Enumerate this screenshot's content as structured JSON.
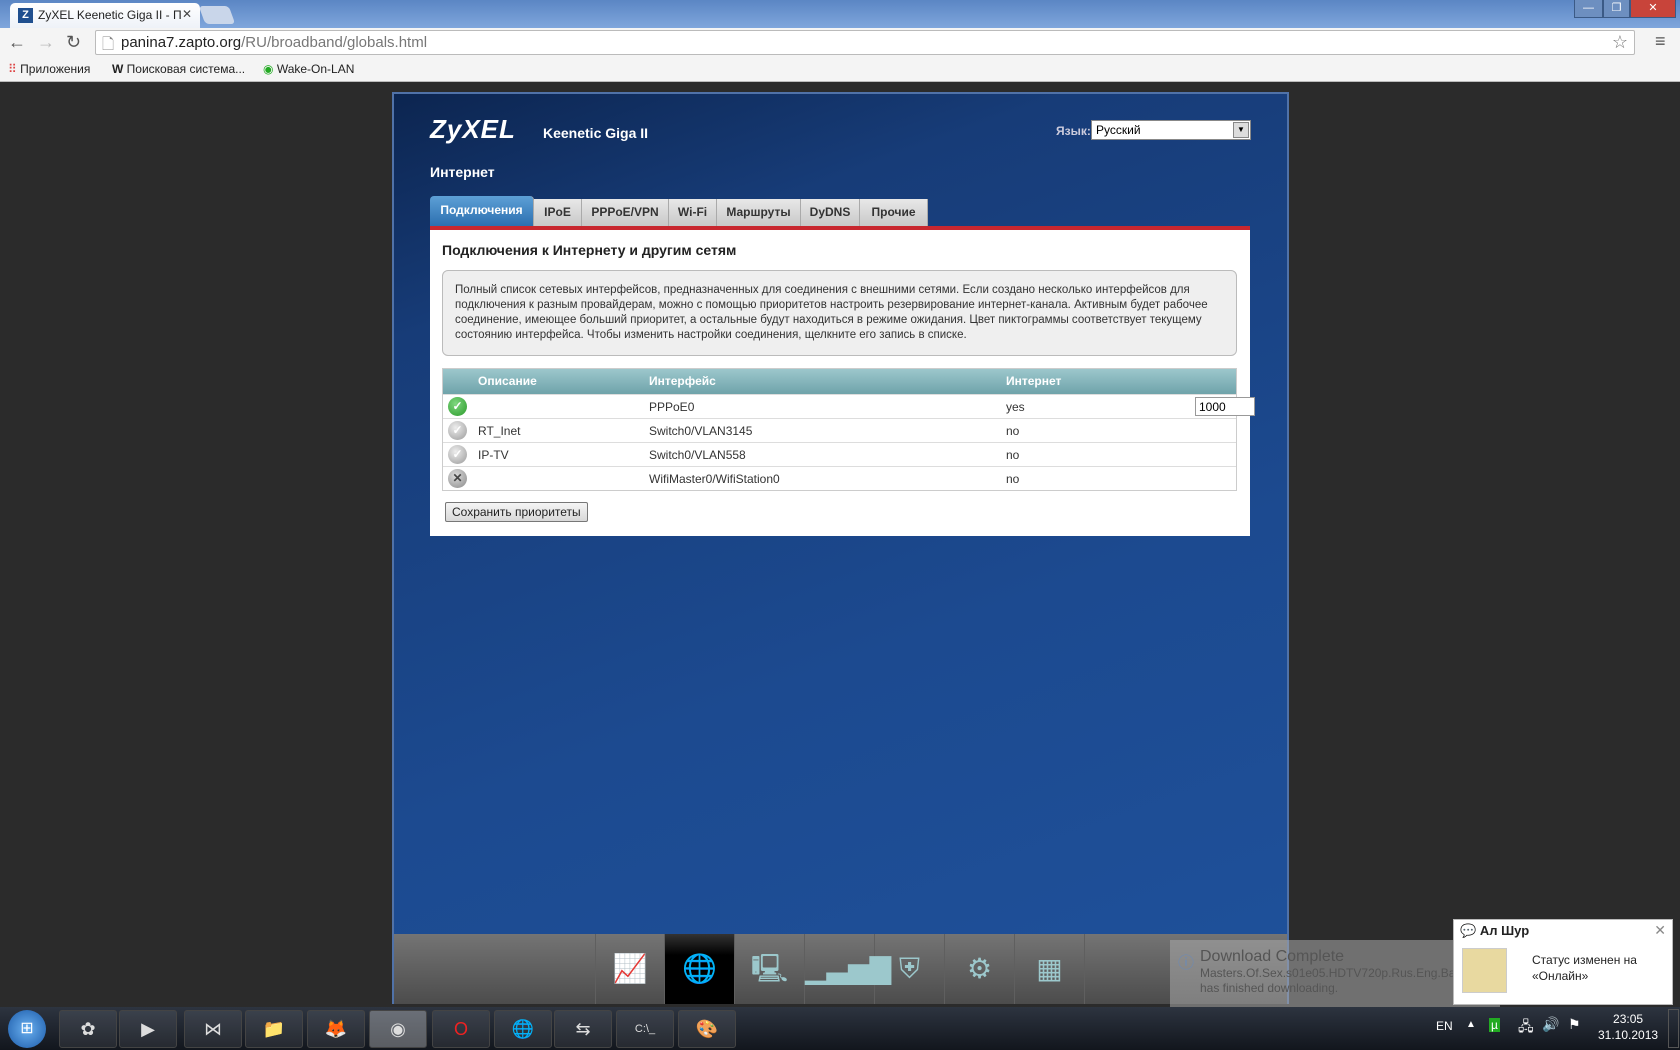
{
  "browser": {
    "tab_title": "ZyXEL Keenetic Giga II - П",
    "url_host": "panina7.zapto.org",
    "url_path": "/RU/broadband/globals.html",
    "bookmarks": [
      {
        "label": "Приложения",
        "icon": "apps-grid-icon"
      },
      {
        "label": "Поисковая система...",
        "icon": "w-icon"
      },
      {
        "label": "Wake-On-LAN",
        "icon": "wol-icon"
      }
    ]
  },
  "router": {
    "brand": "ZyXEL",
    "model": "Keenetic Giga II",
    "lang_label": "Язык:",
    "lang_value": "Русский",
    "section": "Интернет",
    "tabs": [
      {
        "label": "Подключения"
      },
      {
        "label": "IPoE"
      },
      {
        "label": "PPPoE/VPN"
      },
      {
        "label": "Wi-Fi"
      },
      {
        "label": "Маршруты"
      },
      {
        "label": "DyDNS"
      },
      {
        "label": "Прочие"
      }
    ],
    "heading": "Подключения к Интернету и другим сетям",
    "info": "Полный список сетевых интерфейсов, предназначенных для соединения с внешними сетями. Если создано несколько интерфейсов для подключения к разным провайдерам, можно с помощью приоритетов настроить резервирование интернет-канала. Активным будет рабочее соединение, имеющее больший приоритет, а остальные будут находиться в режиме ожидания. Цвет пиктограммы соответствует текущему состоянию интерфейса. Чтобы изменить настройки соединения, щелкните его запись в списке.",
    "columns": {
      "description": "Описание",
      "interface": "Интерфейс",
      "internet": "Интернет"
    },
    "rows": [
      {
        "status": "ok",
        "description": "",
        "interface": "PPPoE0",
        "internet": "yes",
        "priority": "1000"
      },
      {
        "status": "idle",
        "description": "RT_Inet",
        "interface": "Switch0/VLAN3145",
        "internet": "no"
      },
      {
        "status": "idle",
        "description": "IP-TV",
        "interface": "Switch0/VLAN558",
        "internet": "no"
      },
      {
        "status": "off",
        "description": "",
        "interface": "WifiMaster0/WifiStation0",
        "internet": "no"
      }
    ],
    "save_label": "Сохранить приоритеты",
    "bottom_nav": [
      "monitor-icon",
      "internet-globe-icon",
      "home-network-icon",
      "wifi-signal-icon",
      "security-shield-icon",
      "system-gear-icon",
      "apps-icon"
    ]
  },
  "notifications": {
    "download_title": "Download Complete",
    "download_msg": "Masters.Of.Sex.s01e05.HDTV720p.Rus.Eng.BaibaKo.tv.mkv has finished downloading.",
    "chat_name": "Ал Шур",
    "chat_msg": "Статус изменен на «Онлайн»"
  },
  "taskbar": {
    "lang": "EN",
    "time": "23:05",
    "date": "31.10.2013"
  }
}
